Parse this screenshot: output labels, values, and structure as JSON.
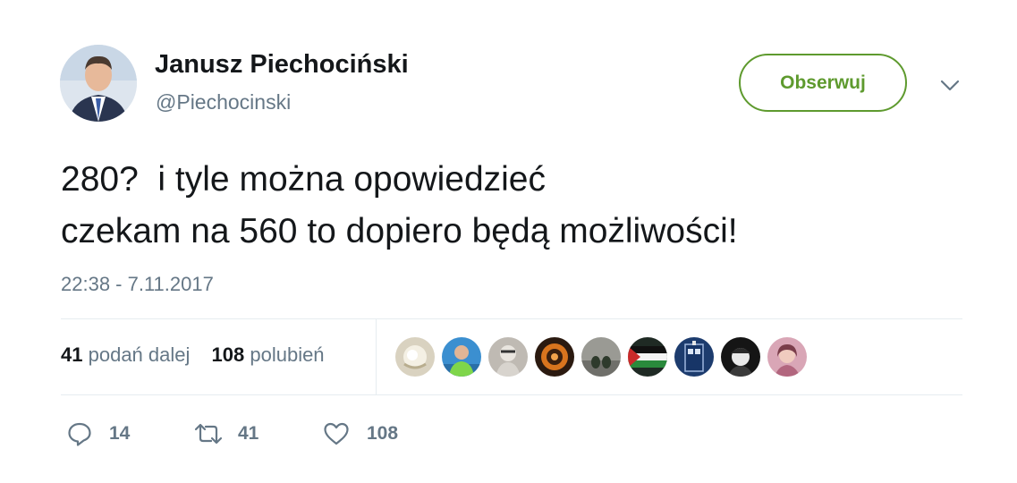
{
  "author": {
    "name": "Janusz Piechociński",
    "handle": "@Piechocinski"
  },
  "follow_button": {
    "label": "Obserwuj"
  },
  "tweet": {
    "lines": [
      "280?  i tyle można opowiedzieć",
      "czekam na 560 to dopiero będą możliwości!"
    ],
    "timestamp": "22:38 - 7.11.2017"
  },
  "stats": {
    "retweets_count": "41",
    "retweets_label": "podań dalej",
    "likes_count": "108",
    "likes_label": "polubień"
  },
  "actions": {
    "replies": "14",
    "retweets": "41",
    "likes": "108"
  },
  "colors": {
    "follow_green": "#5e9a2e",
    "secondary_text": "#657786",
    "divider": "#e6ecf0"
  },
  "icons": {
    "reply": "speech-bubble-icon",
    "retweet": "retweet-arrows-icon",
    "like": "heart-outline-icon",
    "menu": "chevron-down-icon"
  }
}
